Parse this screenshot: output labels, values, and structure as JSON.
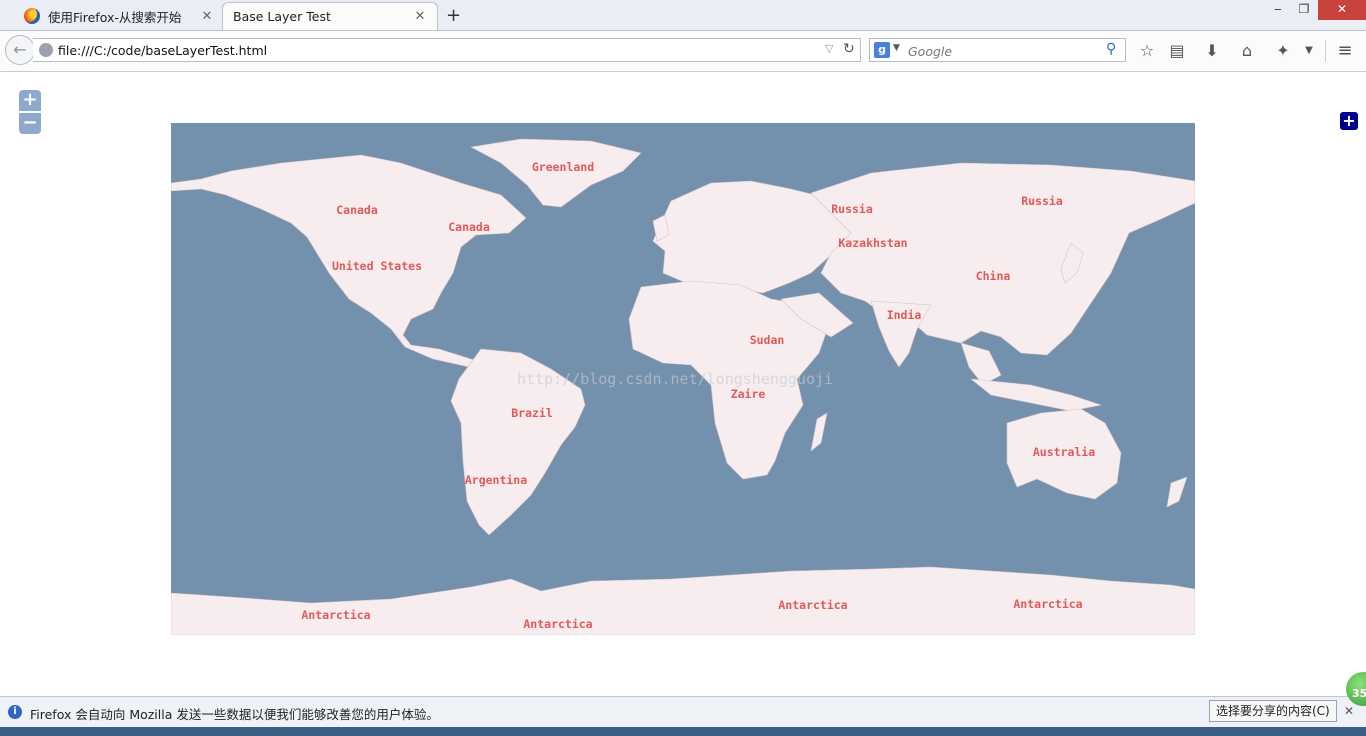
{
  "browser": {
    "tabs": [
      {
        "label": "使用Firefox-从搜索开始",
        "active": false
      },
      {
        "label": "Base Layer Test",
        "active": true
      }
    ],
    "new_tab_symbol": "+",
    "window_controls": {
      "minimize": "‒",
      "maximize": "❐",
      "close": "✕"
    }
  },
  "navbar": {
    "url": "file:///C:/code/baseLayerTest.html",
    "search_placeholder": "Google",
    "search_engine_icon": "google-icon",
    "toolbar_icons": [
      "bookmark-star-icon",
      "reading-list-icon",
      "download-icon",
      "home-icon",
      "addon-icon",
      "menu-icon"
    ]
  },
  "map": {
    "ocean_color": "#7391ad",
    "land_color": "#f7ecee",
    "label_color": "#e05a5a",
    "zoom_in": "+",
    "zoom_out": "−",
    "layer_switcher": "+",
    "watermark": "http://blog.csdn.net/longshengguoji",
    "labels": [
      {
        "text": "Greenland"
      },
      {
        "text": "Canada"
      },
      {
        "text": "Canada"
      },
      {
        "text": "United States"
      },
      {
        "text": "Russia"
      },
      {
        "text": "Russia"
      },
      {
        "text": "Kazakhstan"
      },
      {
        "text": "China"
      },
      {
        "text": "India"
      },
      {
        "text": "Sudan"
      },
      {
        "text": "Zaire"
      },
      {
        "text": "Brazil"
      },
      {
        "text": "Argentina"
      },
      {
        "text": "Australia"
      },
      {
        "text": "Antarctica"
      },
      {
        "text": "Antarctica"
      },
      {
        "text": "Antarctica"
      },
      {
        "text": "Antarctica"
      }
    ]
  },
  "notification": {
    "message": "Firefox 会自动向 Mozilla 发送一些数据以便我们能够改善您的用户体验。",
    "share_button": "选择要分享的内容(C)",
    "close": "✕",
    "badge": "35"
  }
}
